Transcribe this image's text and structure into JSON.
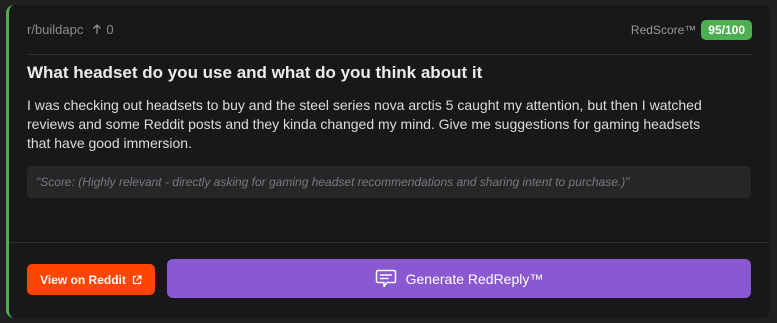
{
  "post": {
    "subreddit": "r/buildapc",
    "upvotes": "0",
    "score_label": "RedScore™",
    "score_value": "95/100",
    "title": "What headset do you use and what do you think about it",
    "body": "I was checking out headsets to buy and the steel series nova arctis 5 caught my attention, but then I watched reviews and some Reddit posts and they kinda changed my mind. Give me suggestions for gaming headsets that have good immersion.",
    "score_note": "\"Score: (Highly relevant - directly asking for gaming headset recommendations and sharing intent to purchase.)\""
  },
  "actions": {
    "view_label": "View on Reddit",
    "view_icon": "external-link-icon",
    "generate_label": "Generate RedReply™",
    "generate_icon": "chat-bubble-icon"
  },
  "colors": {
    "accent_green": "#4caf50",
    "reddit_orange": "#ff4500",
    "purple": "#8a58d0"
  }
}
